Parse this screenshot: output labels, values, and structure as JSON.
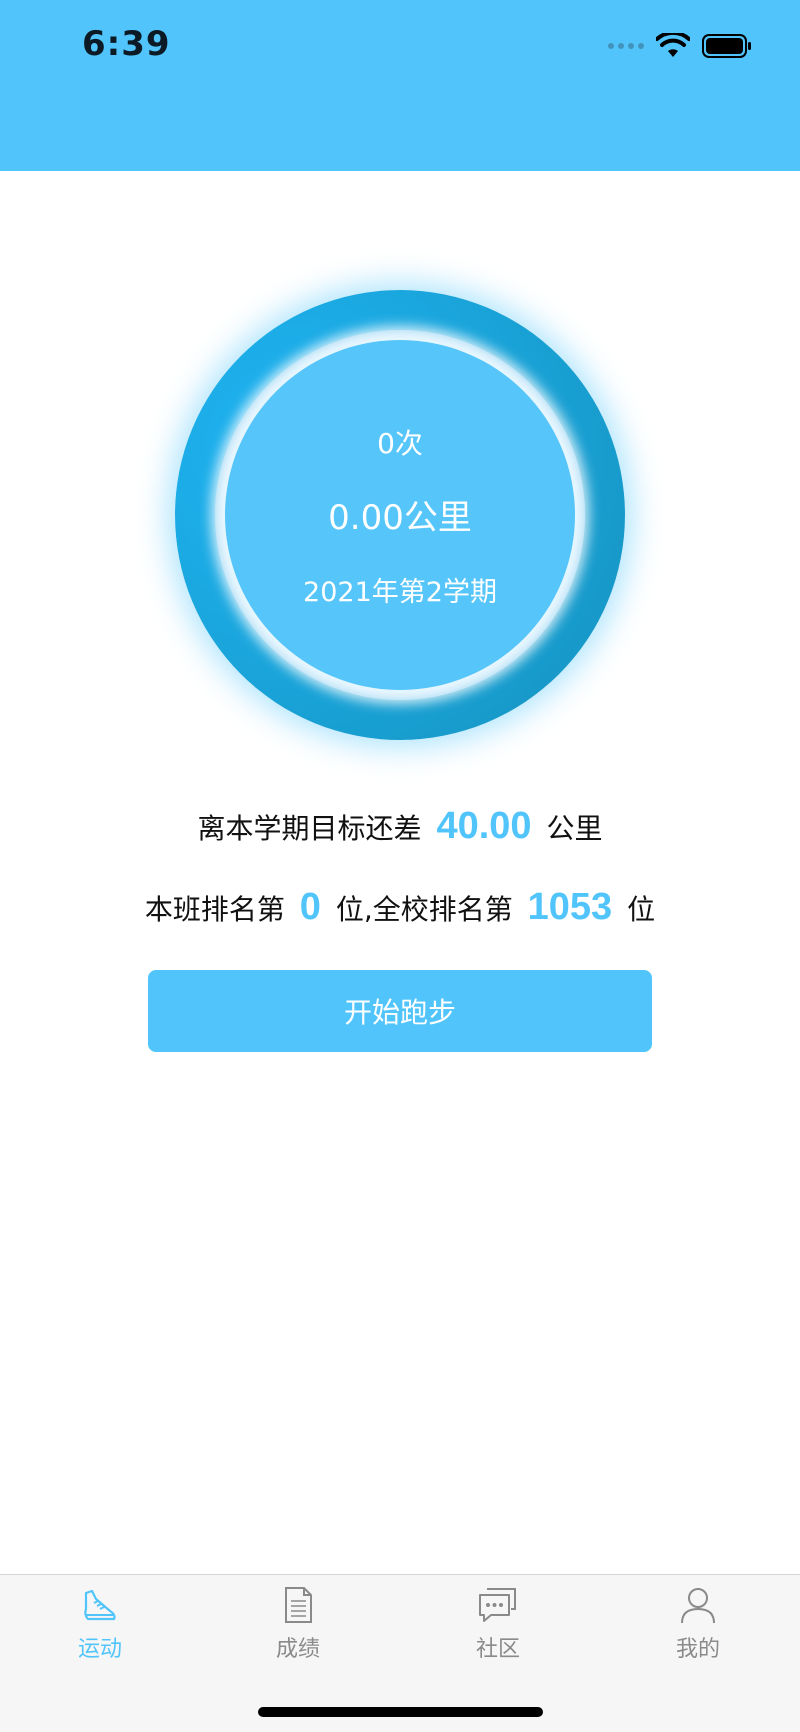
{
  "status_bar": {
    "time": "6:39"
  },
  "summary": {
    "times": "0次",
    "distance": "0.00公里",
    "term": "2021年第2学期"
  },
  "goal": {
    "prefix": "离本学期目标还差",
    "value": "40.00",
    "suffix": "公里"
  },
  "ranking": {
    "class_prefix": "本班排名第",
    "class_rank": "0",
    "school_prefix": "位,全校排名第",
    "school_rank": "1053",
    "suffix": "位"
  },
  "start_button": {
    "label": "开始跑步"
  },
  "tabs": [
    {
      "label": "运动",
      "icon": "shoe-icon",
      "active": true
    },
    {
      "label": "成绩",
      "icon": "document-icon",
      "active": false
    },
    {
      "label": "社区",
      "icon": "chat-icon",
      "active": false
    },
    {
      "label": "我的",
      "icon": "person-icon",
      "active": false
    }
  ],
  "colors": {
    "accent": "#51c5fb",
    "inactive": "#8a8a8a"
  }
}
